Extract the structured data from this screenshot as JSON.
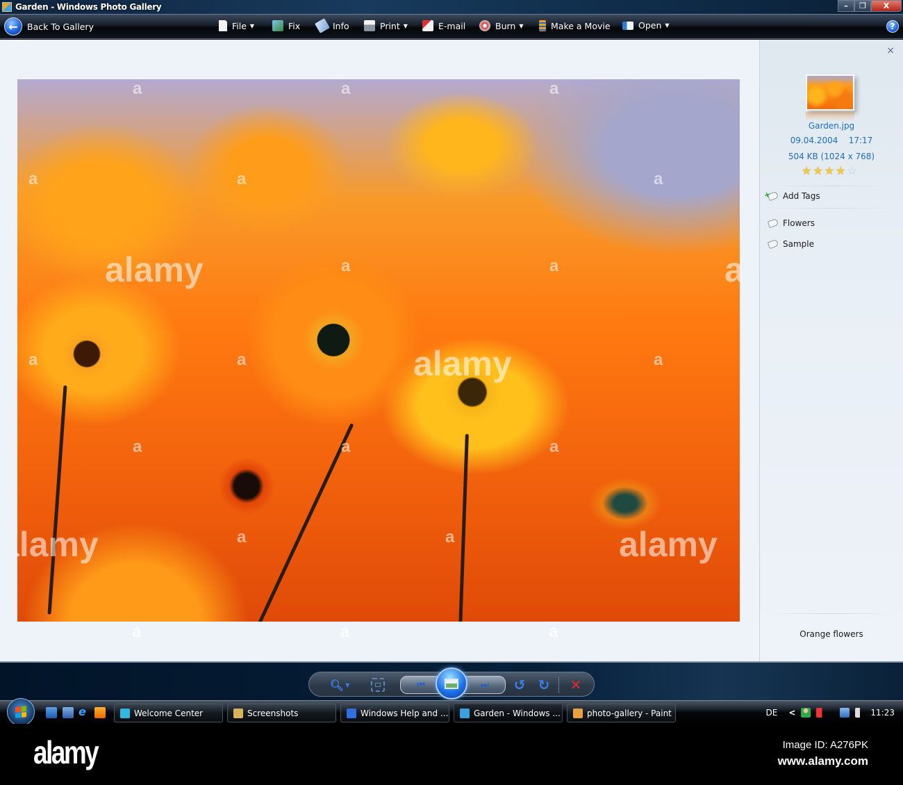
{
  "window": {
    "title": "Garden - Windows Photo Gallery",
    "controls": {
      "minimize": "–",
      "maximize": "❐",
      "close": "X"
    }
  },
  "toolbar": {
    "back_label": "Back To Gallery",
    "items": [
      {
        "label": "File",
        "icon": "file-icon",
        "has_menu": true
      },
      {
        "label": "Fix",
        "icon": "fix-icon",
        "has_menu": false
      },
      {
        "label": "Info",
        "icon": "info-tag-icon",
        "has_menu": false
      },
      {
        "label": "Print",
        "icon": "printer-icon",
        "has_menu": true
      },
      {
        "label": "E-mail",
        "icon": "email-icon",
        "has_menu": false
      },
      {
        "label": "Burn",
        "icon": "disc-icon",
        "has_menu": true
      },
      {
        "label": "Make a Movie",
        "icon": "film-icon",
        "has_menu": false
      },
      {
        "label": "Open",
        "icon": "open-icon",
        "has_menu": true
      }
    ],
    "caret": "▼",
    "help": "?"
  },
  "photo": {
    "description": "Orange daisy flowers",
    "watermarks": [
      "a",
      "alamy"
    ]
  },
  "info_pane": {
    "close": "×",
    "filename": "Garden.jpg",
    "date": "09.04.2004",
    "time": "17:17",
    "size_dims": "504 KB (1024 x 768)",
    "rating": 4,
    "rating_max": 5,
    "star_filled": "★",
    "star_empty": "☆",
    "add_tags_label": "Add Tags",
    "tags": [
      "Flowers",
      "Sample"
    ],
    "caption": "Orange flowers"
  },
  "controls": {
    "zoom": "zoom-icon",
    "actual_size": "fit-to-window-icon",
    "previous": "⏮",
    "play_slideshow": "slideshow-icon",
    "next": "⏭",
    "rotate_ccw": "↺",
    "rotate_cw": "↻",
    "delete": "✕"
  },
  "taskbar": {
    "tasks": [
      {
        "label": "Welcome Center",
        "icon_color": "#2fb8e0"
      },
      {
        "label": "Screenshots",
        "icon_color": "#d9b35b"
      },
      {
        "label": "Windows Help and ...",
        "icon_color": "#2f6fe0"
      },
      {
        "label": "Garden - Windows ...",
        "icon_color": "#3aa0e0",
        "active": true
      },
      {
        "label": "photo-gallery - Paint",
        "icon_color": "#e9a23b"
      }
    ],
    "language": "DE",
    "tray_expand": "<",
    "clock": "11:23"
  },
  "footer": {
    "logo": "alamy",
    "image_id": "Image ID: A276PK",
    "site": "www.alamy.com"
  }
}
